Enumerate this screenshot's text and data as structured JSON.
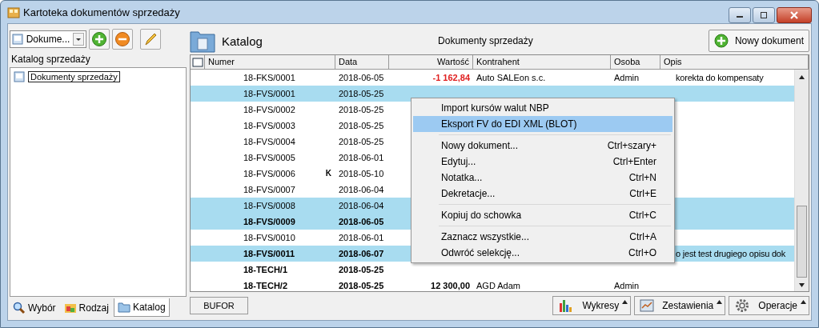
{
  "window": {
    "title": "Kartoteka dokumentów sprzedaży"
  },
  "left_panel": {
    "combo": {
      "value": "Dokume..."
    },
    "tree_label": "Katalog sprzedaży",
    "tree": [
      {
        "label": "Dokumenty sprzedaży",
        "selected": true
      }
    ],
    "tabs": [
      {
        "label": "Wybór",
        "selected": false
      },
      {
        "label": "Rodzaj",
        "selected": false
      },
      {
        "label": "Katalog",
        "selected": true
      }
    ]
  },
  "header": {
    "title": "Katalog",
    "subtitle": "Dokumenty sprzedaży",
    "new_button": "Nowy dokument"
  },
  "table": {
    "select_all": {
      "checked": false
    },
    "columns": [
      "Numer",
      "Data",
      "Wartość",
      "Kontrahent",
      "Osoba",
      "Opis"
    ],
    "rows": [
      {
        "numer": "18-FKS/0001",
        "data": "2018-06-05",
        "wartosc": "-1 162,84",
        "negative": true,
        "kontrahent": "Auto SALEon s.c.",
        "osoba": "Admin",
        "opis": "korekta do kompensaty",
        "bold": false,
        "selected": false
      },
      {
        "numer": "18-FVS/0001",
        "data": "2018-05-25",
        "bold": false,
        "selected": true
      },
      {
        "numer": "18-FVS/0002",
        "data": "2018-05-25",
        "bold": false,
        "selected": false
      },
      {
        "numer": "18-FVS/0003",
        "data": "2018-05-25",
        "bold": false,
        "selected": false
      },
      {
        "numer": "18-FVS/0004",
        "data": "2018-05-25",
        "bold": false,
        "selected": false
      },
      {
        "numer": "18-FVS/0005",
        "data": "2018-06-01",
        "bold": false,
        "selected": false
      },
      {
        "numer": "18-FVS/0006",
        "flag": "K",
        "data": "2018-05-10",
        "bold": false,
        "selected": false
      },
      {
        "numer": "18-FVS/0007",
        "data": "2018-06-04",
        "bold": false,
        "selected": false
      },
      {
        "numer": "18-FVS/0008",
        "data": "2018-06-04",
        "bold": false,
        "selected": true
      },
      {
        "numer": "18-FVS/0009",
        "data": "2018-06-05",
        "bold": true,
        "selected": true
      },
      {
        "numer": "18-FVS/0010",
        "data": "2018-06-01",
        "bold": false,
        "selected": false
      },
      {
        "numer": "18-FVS/0011",
        "data": "2018-06-07",
        "opis": "o jest test drugiego opisu dok",
        "bold": true,
        "selected": true
      },
      {
        "numer": "18-TECH/1",
        "data": "2018-05-25",
        "bold": true,
        "selected": false
      },
      {
        "numer": "18-TECH/2",
        "data": "2018-05-25",
        "wartosc": "12 300,00",
        "negative": false,
        "kontrahent": "AGD Adam",
        "osoba": "Admin",
        "bold": true,
        "selected": false
      }
    ]
  },
  "context_menu": [
    {
      "kind": "item",
      "label": "Import kursów walut NBP",
      "selected": false
    },
    {
      "kind": "item",
      "label": "Eksport FV do EDI XML (BLOT)",
      "selected": true
    },
    {
      "kind": "separator"
    },
    {
      "kind": "item",
      "label": "Nowy dokument...",
      "shortcut": "Ctrl+szary+",
      "selected": false
    },
    {
      "kind": "item",
      "label": "Edytuj...",
      "shortcut": "Ctrl+Enter",
      "selected": false
    },
    {
      "kind": "item",
      "label": "Notatka...",
      "shortcut": "Ctrl+N",
      "selected": false
    },
    {
      "kind": "item",
      "label": "Dekretacje...",
      "shortcut": "Ctrl+E",
      "selected": false
    },
    {
      "kind": "separator"
    },
    {
      "kind": "item",
      "label": "Kopiuj do schowka",
      "shortcut": "Ctrl+C",
      "selected": false
    },
    {
      "kind": "separator"
    },
    {
      "kind": "item",
      "label": "Zaznacz wszystkie...",
      "shortcut": "Ctrl+A",
      "selected": false
    },
    {
      "kind": "item",
      "label": "Odwróć selekcję...",
      "shortcut": "Ctrl+O",
      "selected": false
    }
  ],
  "bottom_bar": {
    "bufor": "BUFOR",
    "buttons": [
      {
        "label": "Wykresy"
      },
      {
        "label": "Zestawienia"
      },
      {
        "label": "Operacje"
      }
    ]
  }
}
